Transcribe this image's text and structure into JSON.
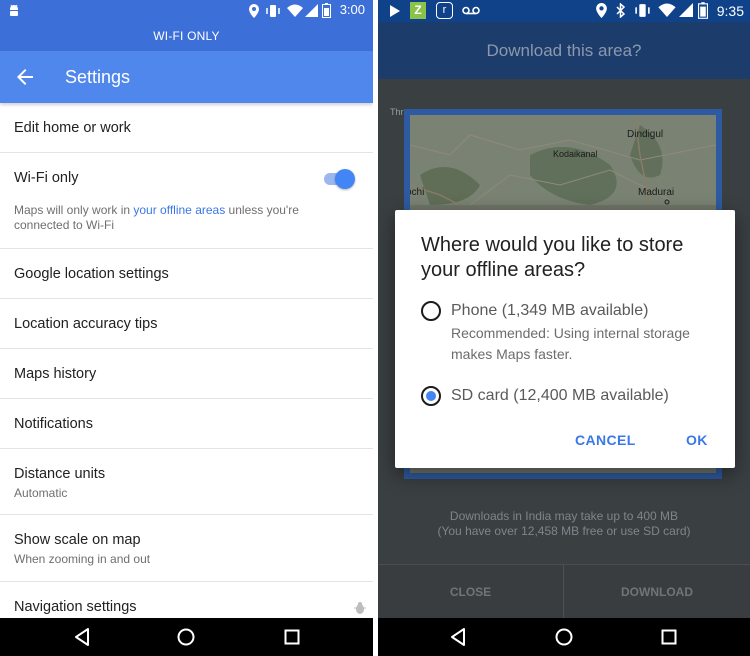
{
  "left": {
    "status_time": "3:00",
    "banner": "WI-FI ONLY",
    "appbar_title": "Settings",
    "items": [
      {
        "title": "Edit home or work"
      },
      {
        "title": "Wi-Fi only",
        "sub_pre": "Maps will only work in ",
        "sub_link": "your offline areas",
        "sub_post": " unless you're connected to Wi-Fi",
        "toggle_on": true
      },
      {
        "title": "Google location settings"
      },
      {
        "title": "Location accuracy tips"
      },
      {
        "title": "Maps history"
      },
      {
        "title": "Notifications"
      },
      {
        "title": "Distance units",
        "sub": "Automatic"
      },
      {
        "title": "Show scale on map",
        "sub": "When zooming in and out"
      },
      {
        "title": "Navigation settings"
      }
    ]
  },
  "right": {
    "status_time": "9:35",
    "header_title": "Download this area?",
    "map_labels": [
      "Dindigul",
      "Kodaikanal",
      "Madurai",
      "ochi",
      "Thr"
    ],
    "note_line1": "Downloads in India may take up to 400 MB",
    "note_line2": "(You have over 12,458 MB free or use SD card)",
    "close_label": "CLOSE",
    "download_label": "DOWNLOAD",
    "dialog": {
      "title": "Where would you like to store your offline areas?",
      "option_phone": "Phone (1,349 MB available)",
      "option_phone_sub": "Recommended: Using internal storage makes Maps faster.",
      "option_sd": "SD card (12,400 MB available)",
      "selected": "sd",
      "cancel_label": "CANCEL",
      "ok_label": "OK"
    }
  },
  "colors": {
    "accent_blue": "#4285f4",
    "appbar_blue": "#4f87ec",
    "link_blue": "#3b78e7"
  }
}
